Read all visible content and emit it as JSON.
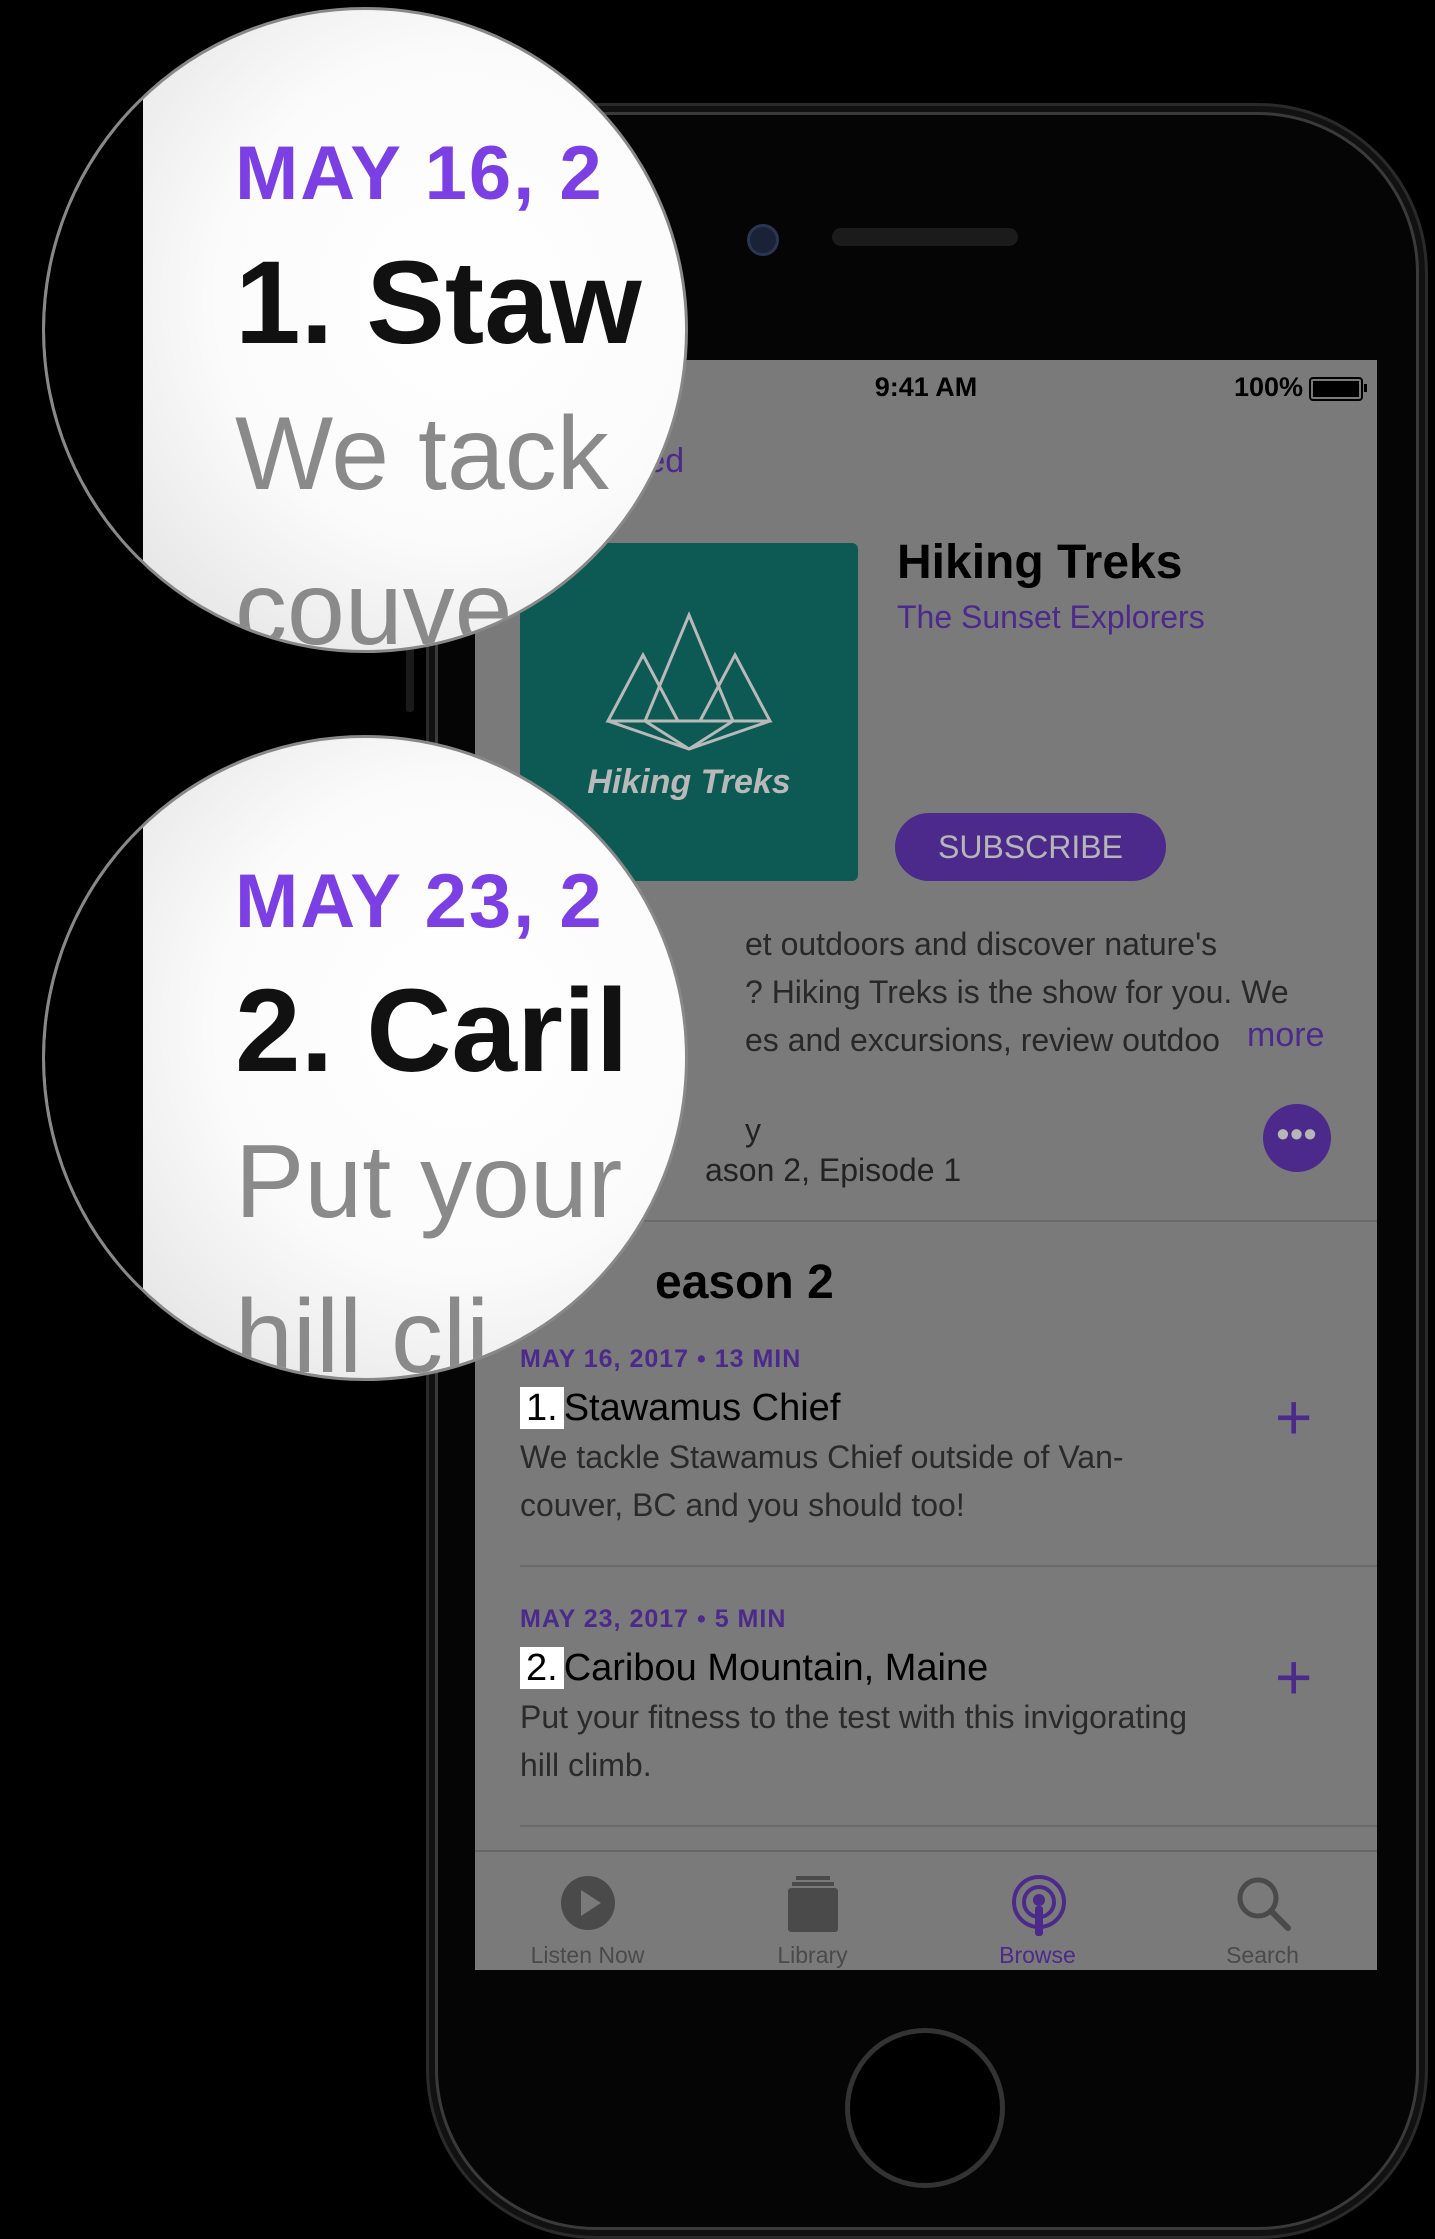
{
  "status": {
    "time": "9:41 AM",
    "battery": "100%"
  },
  "nav": {
    "back_label": "red"
  },
  "podcast": {
    "art_text": "Hiking Treks",
    "title": "Hiking Treks",
    "author": "The Sunset Explorers",
    "subscribe_label": "SUBSCRIBE",
    "desc_line1": "et outdoors and discover nature's",
    "desc_line2": "? Hiking Treks is the show for you. We",
    "desc_line3": "es and excursions, review outdoo",
    "more_label": "more",
    "episode_label_line1": "y",
    "episode_label_line2": "ason 2, Episode 1",
    "more_icon": "ellipsis-icon"
  },
  "season": {
    "title": "eason 2"
  },
  "episodes": [
    {
      "meta": "MAY 16, 2017 • 13 MIN",
      "number": "1.",
      "title": "Stawamus Chief",
      "desc_line1": "We tackle Stawamus Chief outside of Van-",
      "desc_line2": "couver, BC and you should too!"
    },
    {
      "meta": "MAY 23, 2017 • 5 MIN",
      "number": "2.",
      "title": "Caribou Mountain, Maine",
      "desc_line1": "Put your fitness to the test with this invigorating",
      "desc_line2": "hill climb."
    }
  ],
  "tabs": [
    {
      "label": "Listen Now",
      "icon": "play-circle-icon"
    },
    {
      "label": "Library",
      "icon": "library-icon"
    },
    {
      "label": "Browse",
      "icon": "podcast-icon"
    },
    {
      "label": "Search",
      "icon": "search-icon"
    }
  ],
  "magnifier1": {
    "date": "MAY 16, 2",
    "title": "1. Staw",
    "desc1": "We tack",
    "desc2": "couve"
  },
  "magnifier2": {
    "date": "MAY 23, 2",
    "title": "2. Caril",
    "desc1": "Put your",
    "desc2": "hill cli"
  },
  "colors": {
    "accent": "#4b2a8c",
    "magnified_accent": "#7b3fe4",
    "artwork": "#0d5a55"
  }
}
